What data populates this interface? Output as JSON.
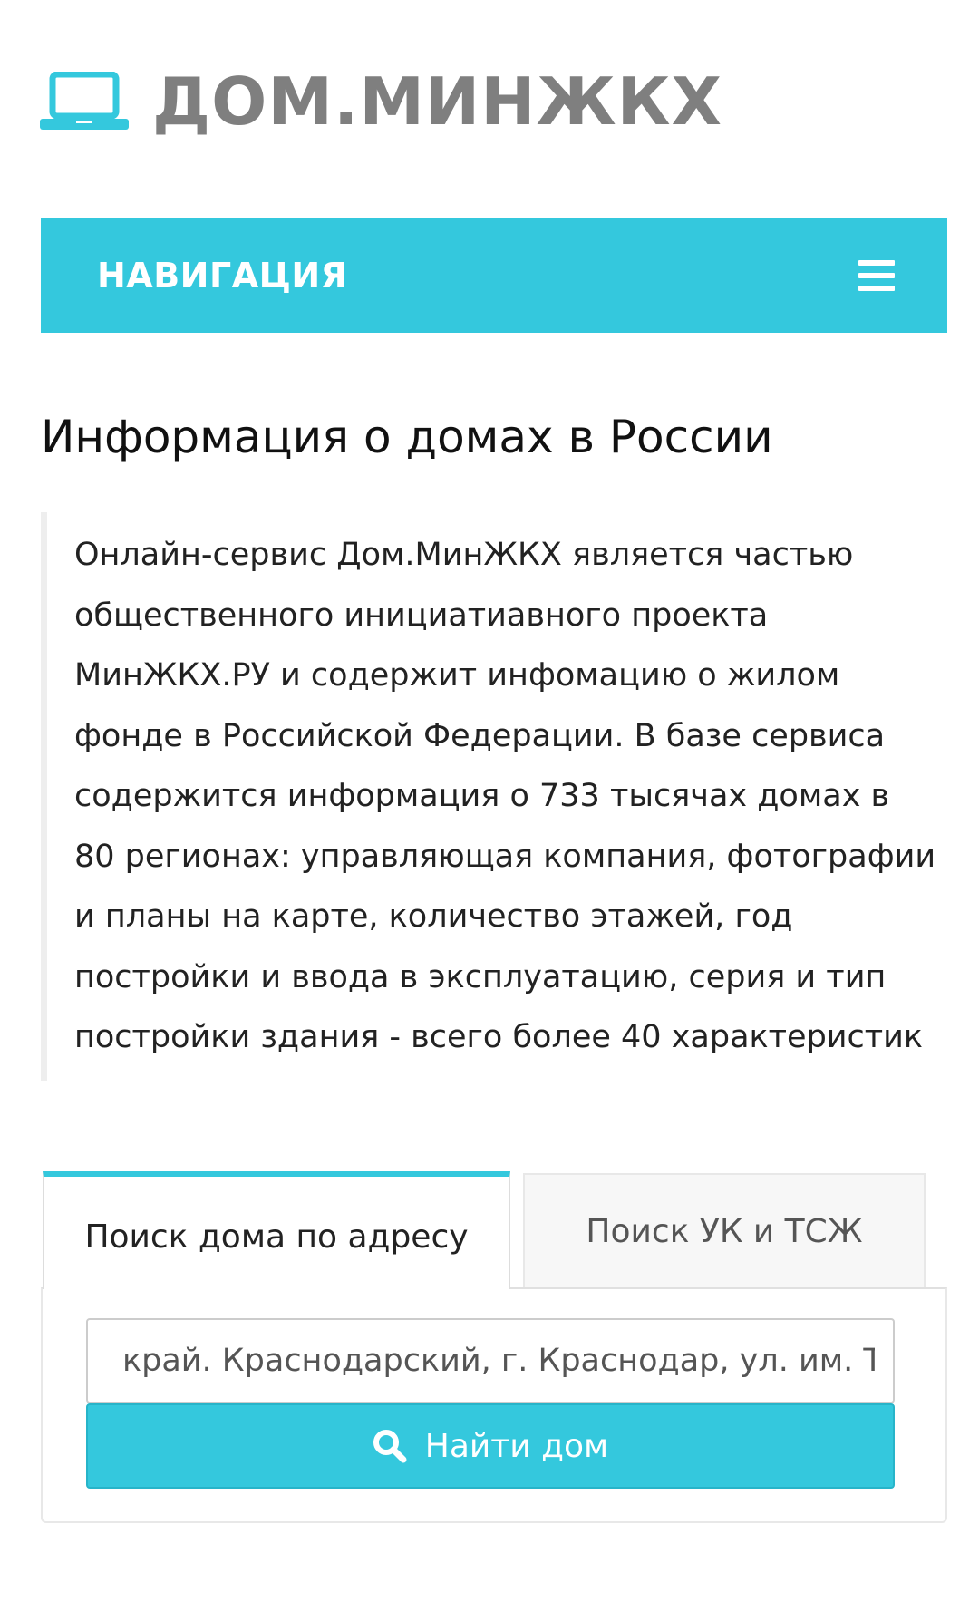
{
  "header": {
    "logo_text": "ДОМ.МИНЖКХ",
    "logo_icon": "laptop-icon"
  },
  "navbar": {
    "label": "НАВИГАЦИЯ",
    "menu_icon": "hamburger-menu-icon"
  },
  "main": {
    "title": "Информация о домах в России",
    "description": "Онлайн-сервис Дом.МинЖКХ является частью общественного инициатиавного проекта МинЖКХ.РУ и содержит инфомацию о жилом фонде в Российской Федерации. В базе сервиса содержится информация о 733 тысячах домах в 80 регионах: управляющая компания, фотографии и планы на карте, количество этажей, год постройки и ввода в эксплуатацию, серия и тип постройки здания - всего более 40 характеристик"
  },
  "tabs": [
    {
      "label": "Поиск дома по адресу",
      "active": true
    },
    {
      "label": "Поиск УК и ТСЖ",
      "active": false
    }
  ],
  "search": {
    "value": "край. Краснодарский, г. Краснодар, ул. им. Тургенева",
    "button_label": "Найти дом",
    "button_icon": "search-icon"
  },
  "colors": {
    "accent": "#34c8dd",
    "logo_text": "#7f7f7f",
    "logo_icon": "#34c8dd"
  }
}
